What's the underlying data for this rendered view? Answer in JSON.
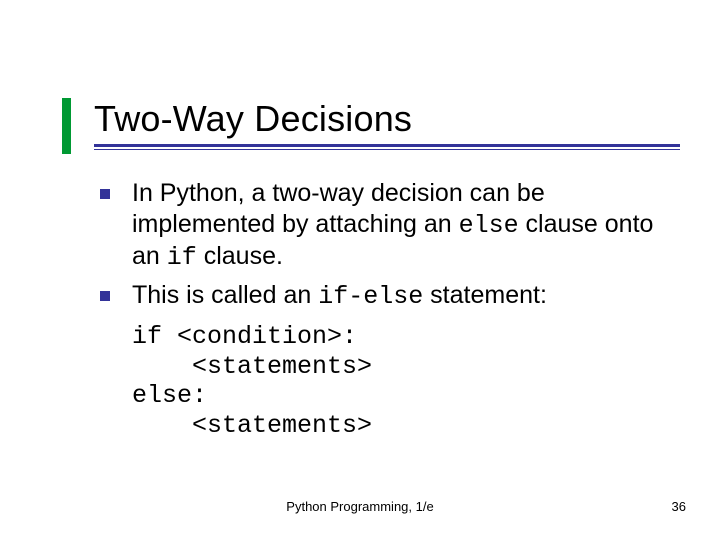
{
  "title": "Two-Way Decisions",
  "bullets": [
    {
      "segments": [
        {
          "text": "In Python, a two-way decision can be implemented by attaching an ",
          "code": false
        },
        {
          "text": "else",
          "code": true
        },
        {
          "text": " clause onto an ",
          "code": false
        },
        {
          "text": "if",
          "code": true
        },
        {
          "text": " clause.",
          "code": false
        }
      ]
    },
    {
      "segments": [
        {
          "text": "This is called an ",
          "code": false
        },
        {
          "text": "if-else",
          "code": true
        },
        {
          "text": " statement:",
          "code": false
        }
      ]
    }
  ],
  "code_lines": [
    "if <condition>:",
    "    <statements>",
    "else:",
    "    <statements>"
  ],
  "footer": {
    "center": "Python Programming, 1/e",
    "page": "36"
  }
}
